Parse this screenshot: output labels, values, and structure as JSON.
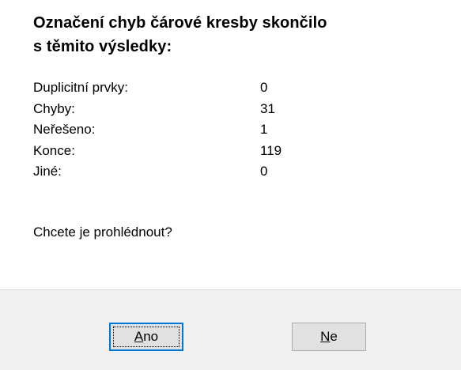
{
  "dialog": {
    "title_line1": "Označení chyb čárové kresby skončilo",
    "title_line2": "s těmito výsledky:",
    "results": [
      {
        "label": "Duplicitní prvky:",
        "value": "0"
      },
      {
        "label": "Chyby:",
        "value": "31"
      },
      {
        "label": "Neřešeno:",
        "value": "1"
      },
      {
        "label": "Konce:",
        "value": "119"
      },
      {
        "label": "Jiné:",
        "value": "0"
      }
    ],
    "question": "Chcete je prohlédnout?",
    "buttons": {
      "yes_mnemonic": "A",
      "yes_rest": "no",
      "no_mnemonic": "N",
      "no_rest": "e"
    }
  }
}
